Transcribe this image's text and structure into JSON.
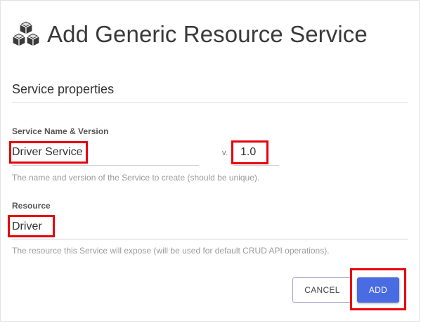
{
  "dialog": {
    "title": "Add Generic Resource Service",
    "title_icon": "cubes-icon"
  },
  "section": {
    "title": "Service properties"
  },
  "service_name": {
    "label": "Service Name & Version",
    "value": "Driver Service",
    "version_prefix": "v.",
    "version_value": "1.0",
    "help": "The name and version of the Service to create (should be unique)."
  },
  "resource": {
    "label": "Resource",
    "value": "Driver",
    "help": "The resource this Service will expose (will be used for default CRUD API operations)."
  },
  "actions": {
    "cancel_label": "CANCEL",
    "add_label": "ADD"
  },
  "colors": {
    "primary": "#4a6ce3",
    "highlight": "#e8000b",
    "cancel_border": "#a79fd1"
  }
}
